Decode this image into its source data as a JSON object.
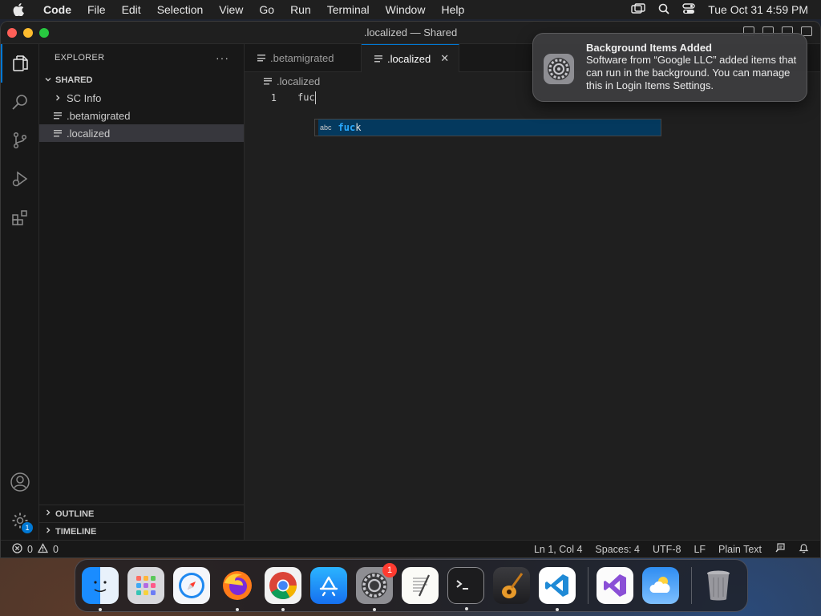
{
  "menubar": {
    "app_name": "Code",
    "items": [
      "File",
      "Edit",
      "Selection",
      "View",
      "Go",
      "Run",
      "Terminal",
      "Window",
      "Help"
    ],
    "datetime": "Tue Oct 31  4:59 PM"
  },
  "window": {
    "title": ".localized — Shared"
  },
  "sidebar": {
    "header": "EXPLORER",
    "more": "···",
    "folder": "SHARED",
    "items": [
      {
        "label": "SC Info",
        "type": "folder"
      },
      {
        "label": ".betamigrated",
        "type": "file"
      },
      {
        "label": ".localized",
        "type": "file",
        "selected": true
      }
    ],
    "outline": "OUTLINE",
    "timeline": "TIMELINE"
  },
  "activitybar": {
    "settings_badge": "1"
  },
  "editor": {
    "tabs": [
      {
        "label": ".betamigrated",
        "active": false
      },
      {
        "label": ".localized",
        "active": true,
        "close": "✕"
      }
    ],
    "breadcrumb": ".localized",
    "lines": [
      {
        "number": "1",
        "text": "fuc"
      }
    ],
    "suggest": {
      "kind": "abc",
      "match": "fuc",
      "rest": "k"
    }
  },
  "statusbar": {
    "errors": "0",
    "warnings": "0",
    "position": "Ln 1, Col 4",
    "spaces": "Spaces: 4",
    "encoding": "UTF-8",
    "eol": "LF",
    "language": "Plain Text"
  },
  "notification": {
    "title": "Background Items Added",
    "body": "Software from “Google LLC” added items that can run in the background. You can manage this in Login Items Settings."
  },
  "dock": {
    "apps": [
      "Finder",
      "Launchpad",
      "Safari",
      "Firefox",
      "Chrome",
      "App Store",
      "System Settings",
      "TextEdit",
      "Terminal",
      "GarageBand",
      "Visual Studio Code",
      "Visual Studio",
      "Weather",
      "Trash"
    ],
    "settings_badge": "1"
  }
}
